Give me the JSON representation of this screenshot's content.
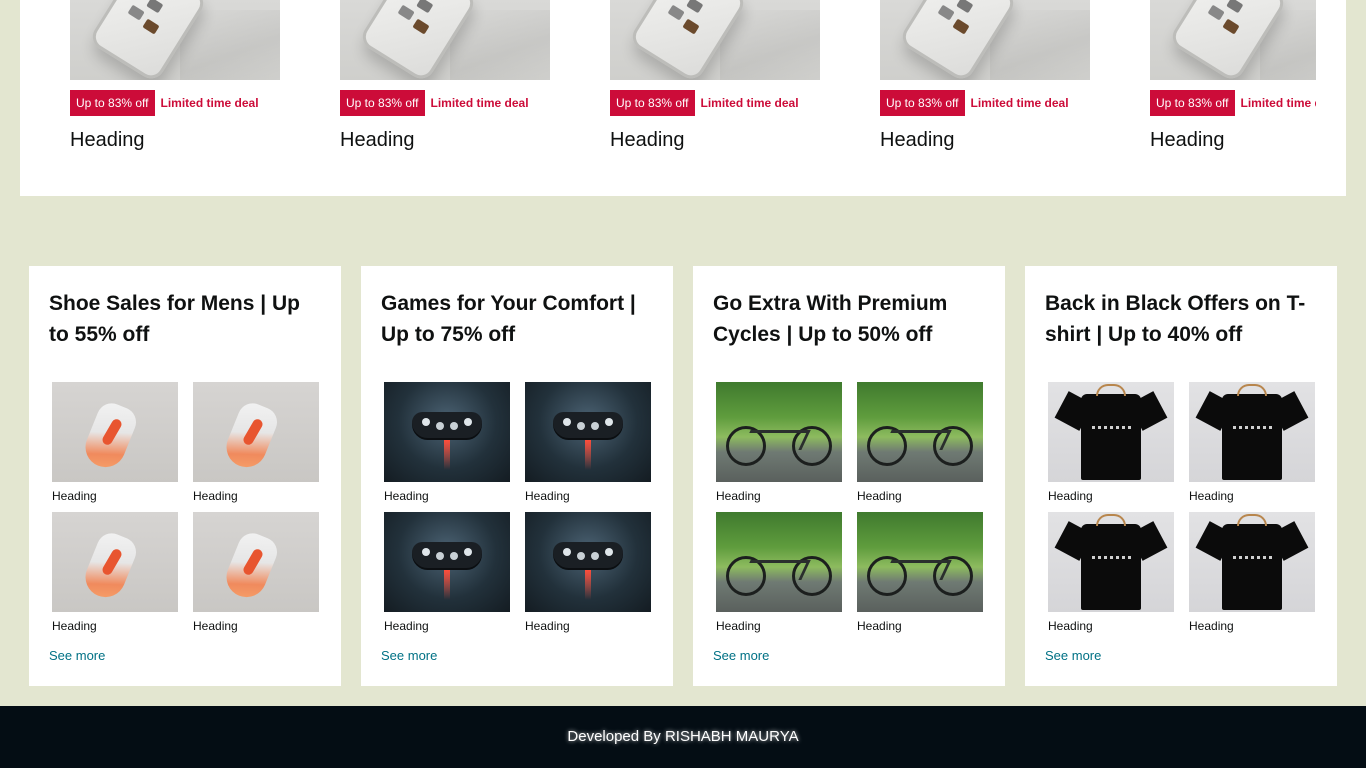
{
  "deals": {
    "items": [
      {
        "badge": "Up to 83% off",
        "deal_text": "Limited time deal",
        "heading": "Heading"
      },
      {
        "badge": "Up to 83% off",
        "deal_text": "Limited time deal",
        "heading": "Heading"
      },
      {
        "badge": "Up to 83% off",
        "deal_text": "Limited time deal",
        "heading": "Heading"
      },
      {
        "badge": "Up to 83% off",
        "deal_text": "Limited time deal",
        "heading": "Heading"
      },
      {
        "badge": "Up to 83% off",
        "deal_text": "Limited time deal",
        "heading": "Heading"
      }
    ],
    "badge_color": "#cc0c39"
  },
  "cards": [
    {
      "title": "Shoe Sales for Mens | Up to 55% off",
      "image_kind": "shoe",
      "items": [
        {
          "label": "Heading"
        },
        {
          "label": "Heading"
        },
        {
          "label": "Heading"
        },
        {
          "label": "Heading"
        }
      ],
      "see_more": "See more"
    },
    {
      "title": "Games for Your Comfort | Up to 75% off",
      "image_kind": "game-controller",
      "items": [
        {
          "label": "Heading"
        },
        {
          "label": "Heading"
        },
        {
          "label": "Heading"
        },
        {
          "label": "Heading"
        }
      ],
      "see_more": "See more"
    },
    {
      "title": "Go Extra With Premium Cycles | Up to 50% off",
      "image_kind": "bicycle",
      "items": [
        {
          "label": "Heading"
        },
        {
          "label": "Heading"
        },
        {
          "label": "Heading"
        },
        {
          "label": "Heading"
        }
      ],
      "see_more": "See more"
    },
    {
      "title": "Back in Black Offers on T-shirt | Up to 40% off",
      "image_kind": "t-shirt",
      "items": [
        {
          "label": "Heading"
        },
        {
          "label": "Heading"
        },
        {
          "label": "Heading"
        },
        {
          "label": "Heading"
        }
      ],
      "see_more": "See more"
    }
  ],
  "footer": {
    "text": "Developed By RISHABH MAURYA"
  },
  "colors": {
    "page_bg": "#e3e6d0",
    "link": "#007185",
    "footer_bg": "#040d14"
  }
}
